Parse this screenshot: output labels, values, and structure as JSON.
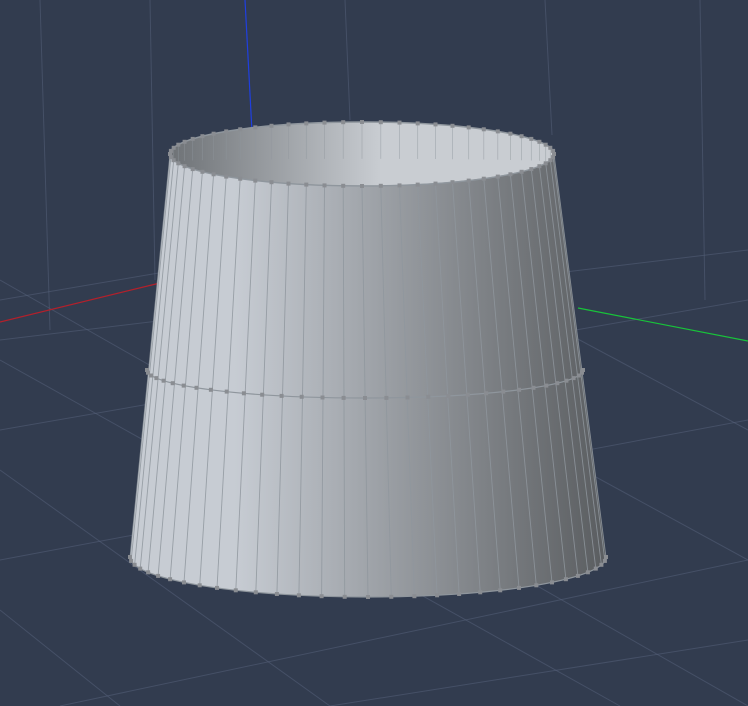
{
  "viewport": {
    "background_color": "#323c4f",
    "grid_color": "#56607a",
    "axes": {
      "x_axis_color": "#b3202b",
      "y_axis_color": "#1f3fe0",
      "z_axis_color": "#18c33a"
    }
  },
  "mesh": {
    "object_type": "truncated-cone",
    "selection": "vertex-mode",
    "surface_light": "#c7ccd3",
    "surface_dark": "#5a5d60",
    "inner_light": "#c9cdd2",
    "inner_dark": "#6e7276",
    "edge_color": "#8f969d",
    "vertex_color": "#8a8d92",
    "edge_loops": 3,
    "segments": 64
  }
}
